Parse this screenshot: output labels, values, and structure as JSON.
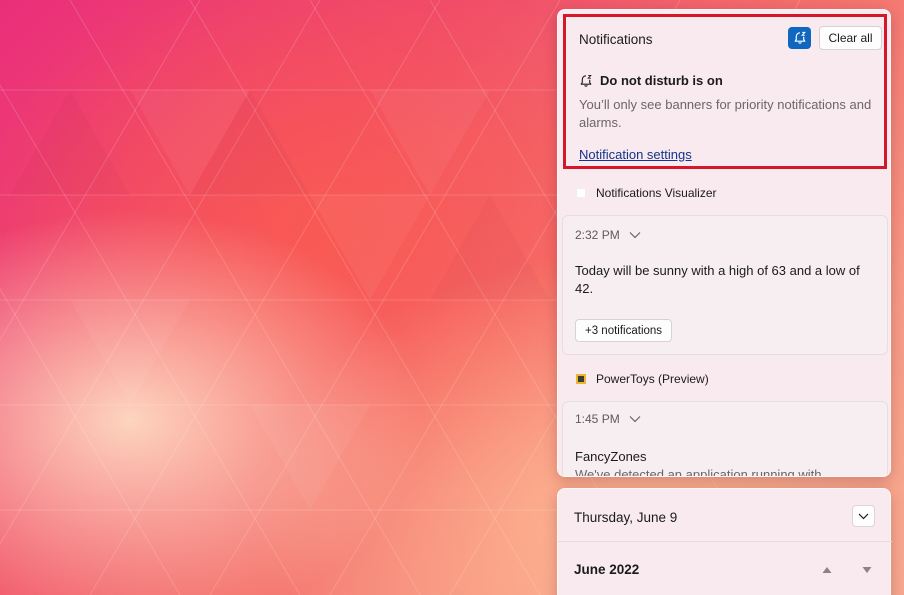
{
  "notifications": {
    "title": "Notifications",
    "clear_all_label": "Clear all",
    "dnd": {
      "title": "Do not disturb is on",
      "description": "You’ll only see banners for priority notifications and alarms."
    },
    "settings_link": "Notification settings",
    "groups": [
      {
        "app_name": "Notifications Visualizer",
        "time": "2:32 PM",
        "body": "Today will be sunny with a high of 63 and a low of 42.",
        "more_label": "+3 notifications"
      },
      {
        "app_name": "PowerToys (Preview)",
        "time": "1:45 PM",
        "title": "FancyZones",
        "body": "We've detected an application running with"
      }
    ]
  },
  "calendar": {
    "date": "Thursday, June 9",
    "month": "June 2022"
  },
  "colors": {
    "accent": "#0f67c0",
    "highlight_border": "#d5172a",
    "link": "#12348c"
  },
  "icons": {
    "dnd_toggle": "dnd-bell-icon",
    "dnd_status": "dnd-bell-icon",
    "collapse": "chevron-down-icon",
    "expand_group": "chevron-down-icon",
    "prev_month": "caret-up-icon",
    "next_month": "caret-down-icon"
  }
}
